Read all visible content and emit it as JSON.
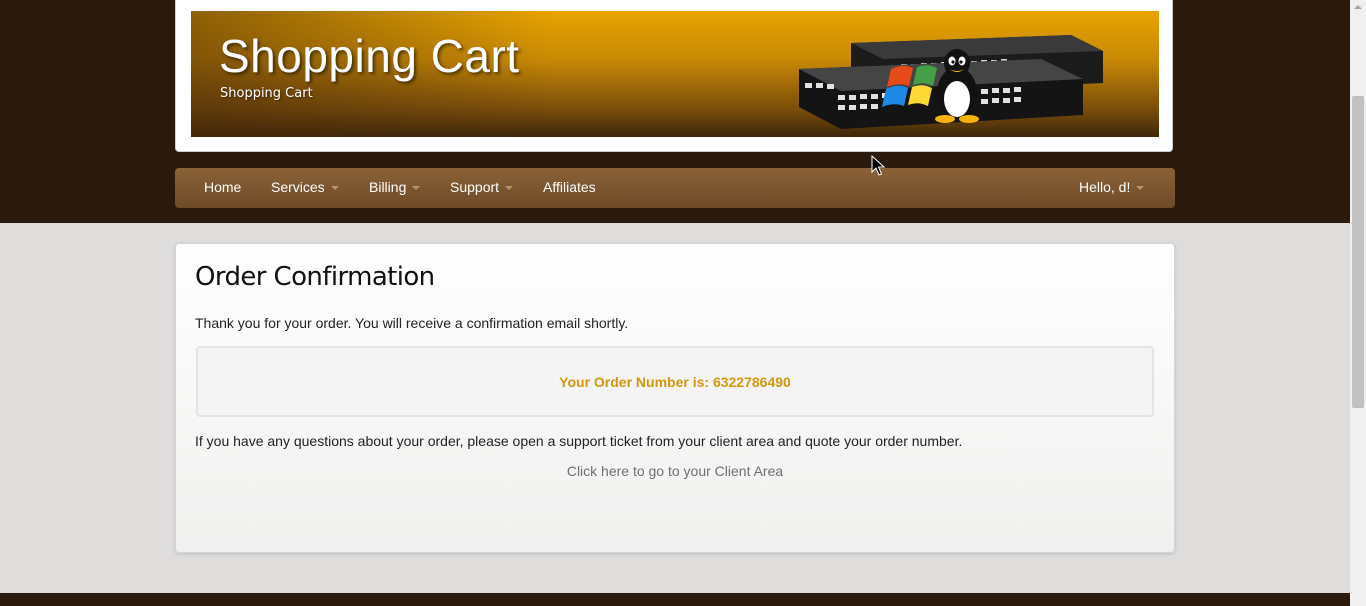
{
  "header": {
    "title": "Shopping Cart",
    "subtitle": "Shopping Cart",
    "banner_art": "network-switch-with-os-logos"
  },
  "nav": {
    "home": "Home",
    "services": "Services",
    "billing": "Billing",
    "support": "Support",
    "affiliates": "Affiliates",
    "account": "Hello, d!"
  },
  "content": {
    "title": "Order Confirmation",
    "intro": "Thank you for your order. You will receive a confirmation email shortly.",
    "order_number": "Your Order Number is: 6322786490",
    "help": "If you have any questions about your order, please open a support ticket from your client area and quote your order number.",
    "client_area_link": "Click here to go to your Client Area"
  },
  "colors": {
    "background_dark": "#2a1a0d",
    "nav_brown": "#7a5530",
    "accent_gold": "#d4960d",
    "page_grey": "#dedddc"
  }
}
